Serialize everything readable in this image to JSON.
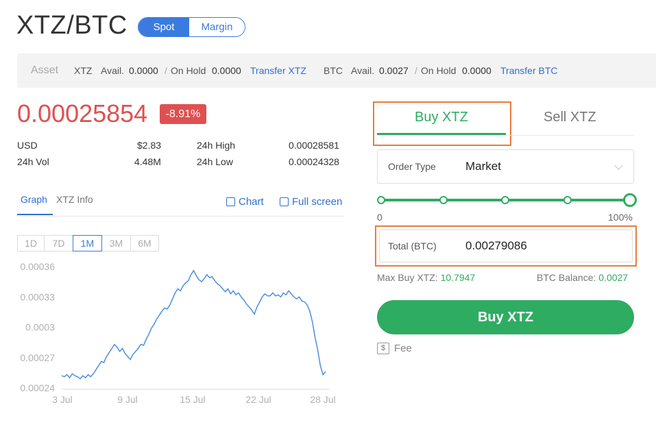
{
  "header": {
    "pair": "XTZ/BTC",
    "modes": [
      "Spot",
      "Margin"
    ],
    "active_mode": "Spot"
  },
  "asset_bar": {
    "label": "Asset",
    "xtz": {
      "symbol": "XTZ",
      "avail_label": "Avail.",
      "avail": "0.0000",
      "sep": "/",
      "on_hold_label": "On Hold",
      "on_hold": "0.0000",
      "transfer_label": "Transfer XTZ"
    },
    "btc": {
      "symbol": "BTC",
      "avail_label": "Avail.",
      "avail": "0.0027",
      "sep": "/",
      "on_hold_label": "On Hold",
      "on_hold": "0.0000",
      "transfer_label": "Transfer BTC"
    }
  },
  "ticker": {
    "price": "0.00025854",
    "change": "-8.91%",
    "usd_label": "USD",
    "usd_value": "$2.83",
    "vol_label": "24h Vol",
    "vol_value": "4.48M",
    "high_label": "24h High",
    "high_value": "0.00028581",
    "low_label": "24h Low",
    "low_value": "0.00024328"
  },
  "graph_panel": {
    "tabs": [
      "Graph",
      "XTZ Info"
    ],
    "active_tab": "Graph",
    "chart_link": "Chart",
    "fullscreen_link": "Full screen",
    "ranges": [
      "1D",
      "7D",
      "1M",
      "3M",
      "6M"
    ],
    "active_range": "1M"
  },
  "chart_data": {
    "type": "line",
    "series": [
      {
        "values": [
          0.000252,
          0.000251,
          0.000253,
          0.00025,
          0.000254,
          0.000252,
          0.000251,
          0.000249,
          0.000252,
          0.00025,
          0.000253,
          0.000251,
          0.000254,
          0.000258,
          0.000262,
          0.000266,
          0.000265,
          0.000271,
          0.000275,
          0.000279,
          0.000283,
          0.00028,
          0.000276,
          0.000279,
          0.000274,
          0.000271,
          0.000268,
          0.000273,
          0.000276,
          0.000279,
          0.000283,
          0.000282,
          0.000288,
          0.000293,
          0.000299,
          0.000303,
          0.000308,
          0.000312,
          0.000316,
          0.000319,
          0.000318,
          0.000322,
          0.000328,
          0.000334,
          0.000338,
          0.000336,
          0.000341,
          0.000344,
          0.000346,
          0.000352,
          0.000356,
          0.000351,
          0.000347,
          0.000345,
          0.000348,
          0.000352,
          0.000349,
          0.00035,
          0.000346,
          0.000343,
          0.000341,
          0.000338,
          0.000335,
          0.000338,
          0.000333,
          0.000336,
          0.000332,
          0.000334,
          0.00033,
          0.000327,
          0.000323,
          0.00032,
          0.000317,
          0.000313,
          0.00032,
          0.000325,
          0.00033,
          0.000333,
          0.000331,
          0.000331,
          0.000334,
          0.000331,
          0.000332,
          0.00033,
          0.000334,
          0.000332,
          0.000336,
          0.000333,
          0.00033,
          0.000328,
          0.00033,
          0.000326,
          0.000325,
          0.000322,
          0.000316,
          0.000305,
          0.00029,
          0.000278,
          0.000262,
          0.000253,
          0.000256
        ]
      }
    ],
    "x_tick_labels": [
      "3 Jul",
      "9 Jul",
      "15 Jul",
      "22 Jul",
      "28 Jul"
    ],
    "y_tick_labels": [
      "0.00036",
      "0.00033",
      "0.0003",
      "0.00027",
      "0.00024"
    ],
    "ylim": [
      0.00024,
      0.00036
    ],
    "color": "#4a90e2"
  },
  "trade_panel": {
    "tabs": [
      "Buy XTZ",
      "Sell XTZ"
    ],
    "active_tab": "Buy XTZ",
    "order_type_label": "Order Type",
    "order_type_value": "Market",
    "slider_level": 1.0,
    "slider_min_label": "0",
    "slider_max_label": "100%",
    "total_label": "Total (BTC)",
    "total_value": "0.00279086",
    "max_buy_label": "Max Buy XTZ:",
    "max_buy_value": "10.7947",
    "balance_label": "BTC Balance:",
    "balance_value": "0.0027",
    "buy_button": "Buy XTZ",
    "fee_label": "Fee",
    "fee_icon": "$"
  },
  "colors": {
    "accent_blue": "#3b7be0",
    "buy_green": "#2eac62",
    "price_red": "#e05050",
    "highlight_orange": "#e87c3e"
  }
}
